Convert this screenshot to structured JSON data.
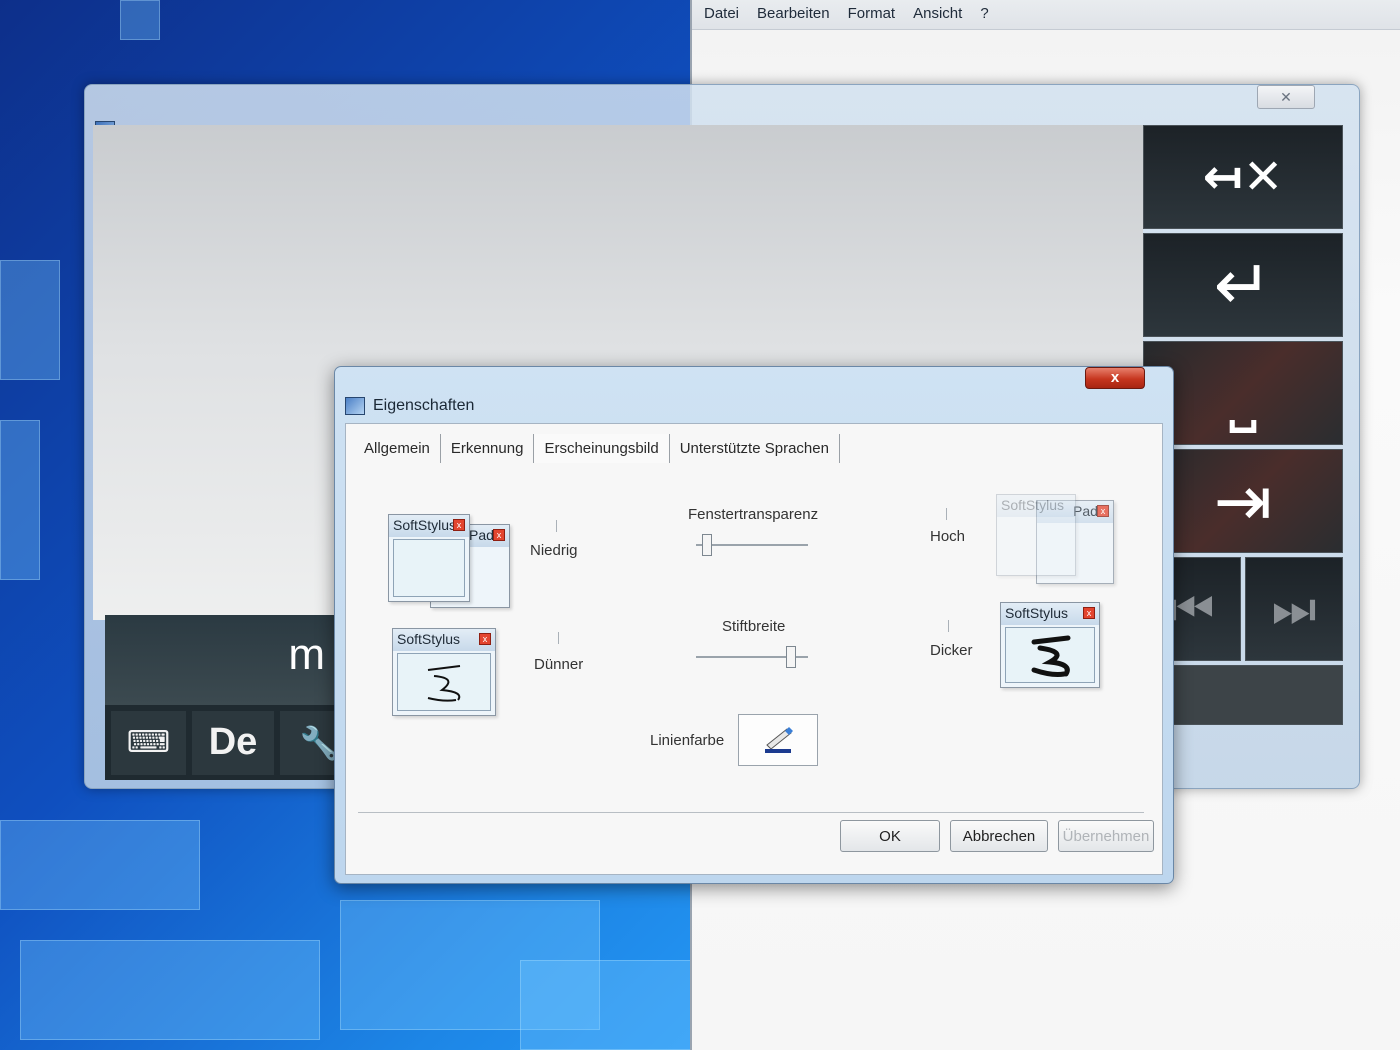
{
  "notepad": {
    "menu": [
      "Datei",
      "Bearbeiten",
      "Format",
      "Ansicht",
      "?"
    ]
  },
  "tip": {
    "close_glyph": "✕",
    "preview_text": "m",
    "bottom_buttons": {
      "keyboard_glyph": "⌨",
      "language_label": "De",
      "tools_glyph": "🔧"
    },
    "side_buttons": {
      "backspace": "↤✕",
      "enter": "↵",
      "space": "⎵",
      "tab": "⇥",
      "prev": "⏮",
      "next": "⏭"
    }
  },
  "dialog": {
    "title": "Eigenschaften",
    "close_glyph": "x",
    "tabs": [
      "Allgemein",
      "Erkennung",
      "Erscheinungsbild",
      "Unterstützte Sprachen"
    ],
    "active_tab_index": 2,
    "transparency": {
      "label": "Fenstertransparenz",
      "min_label": "Niedrig",
      "max_label": "Hoch",
      "value_fraction": 0.1
    },
    "pen_width": {
      "label": "Stiftbreite",
      "min_label": "Dünner",
      "max_label": "Dicker",
      "value_fraction": 0.85
    },
    "line_color": {
      "label": "Linienfarbe"
    },
    "preview_labels": {
      "softstylus": "SoftStylus",
      "pad": "Pad"
    },
    "buttons": {
      "ok": "OK",
      "cancel": "Abbrechen",
      "apply": "Übernehmen"
    }
  }
}
